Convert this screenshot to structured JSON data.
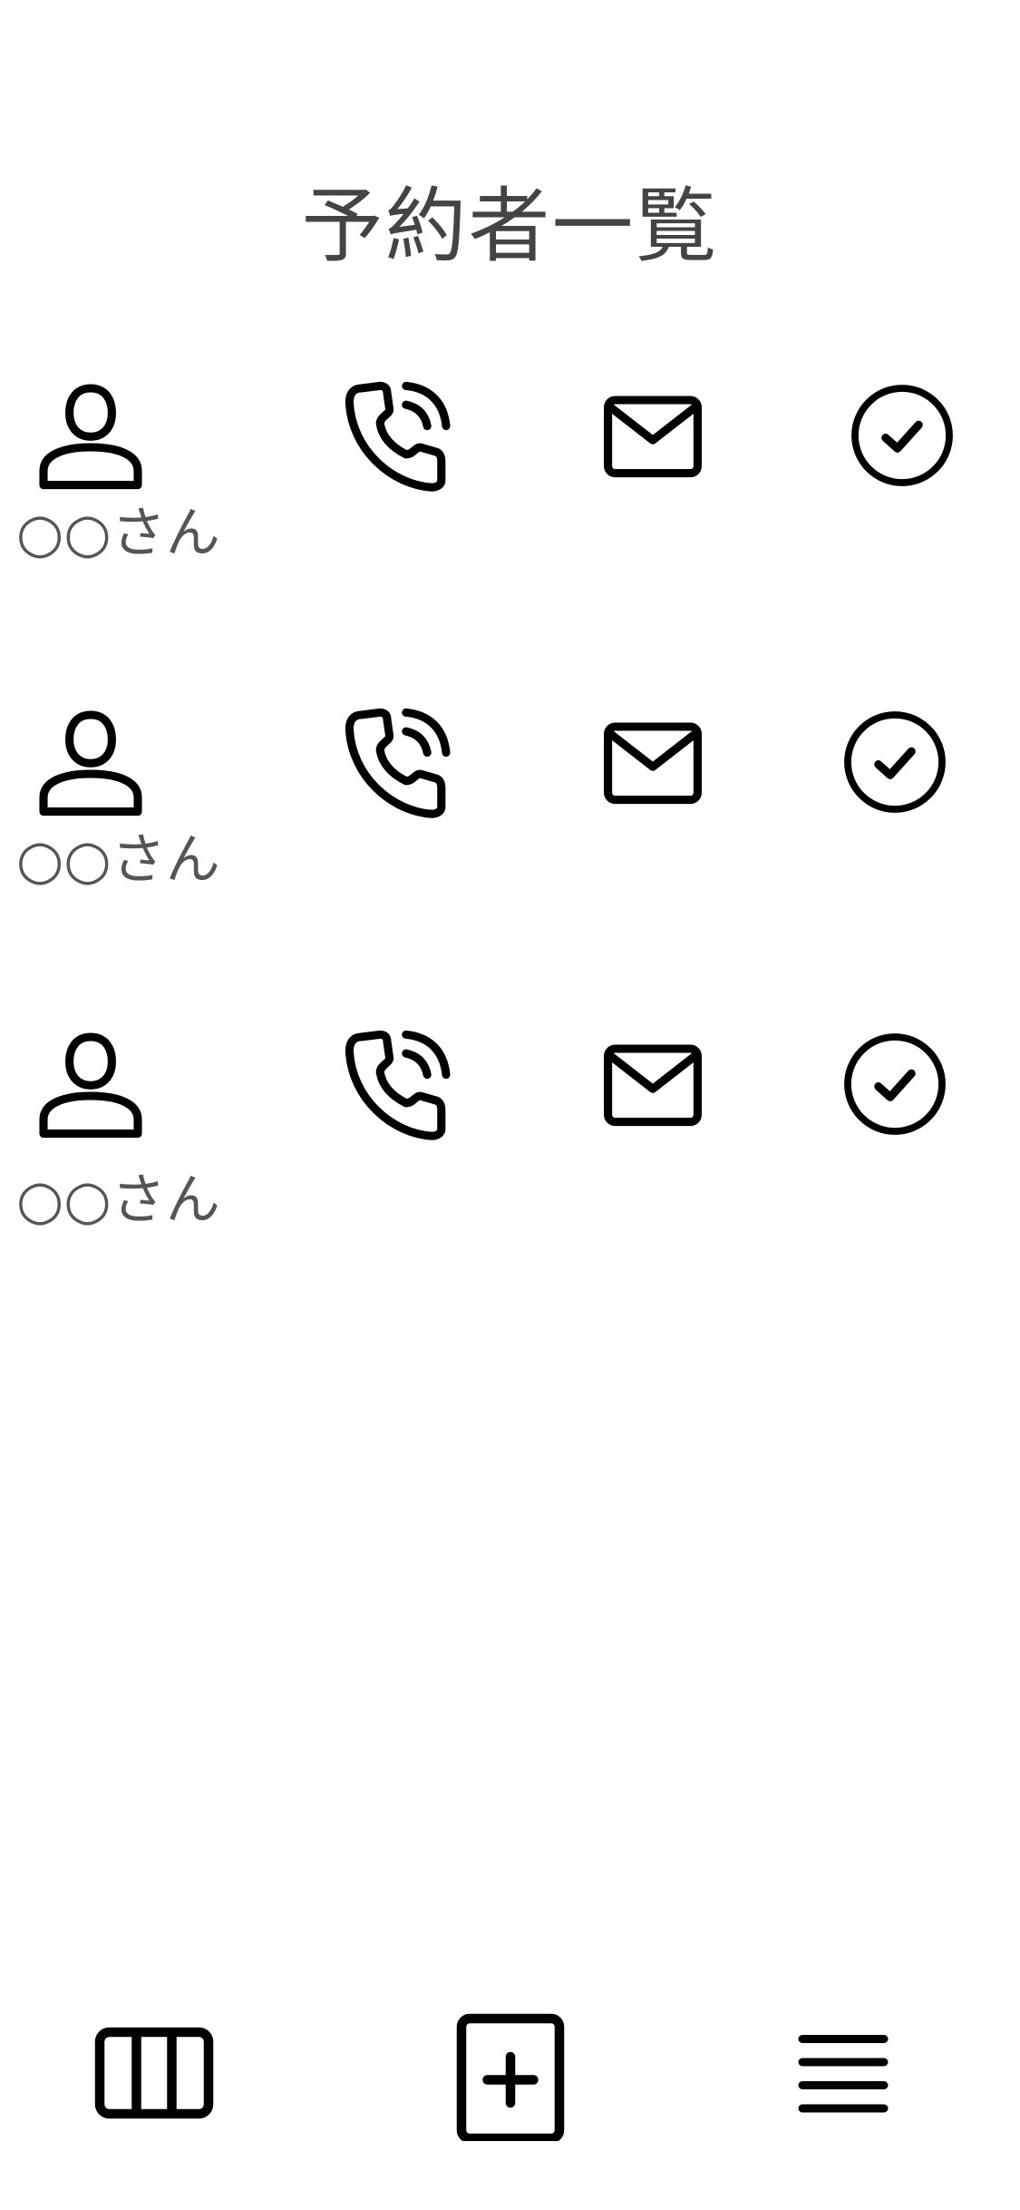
{
  "header": {
    "title": "予約者一覧"
  },
  "reservations": [
    {
      "name": "○○さん"
    },
    {
      "name": "○○さん"
    },
    {
      "name": "○○さん"
    }
  ],
  "row_icons": [
    "person-icon",
    "phone-icon",
    "mail-icon",
    "check-circle-icon"
  ],
  "bottom_nav": {
    "icons": [
      "columns-icon",
      "add-square-icon",
      "menu-icon"
    ]
  },
  "colors": {
    "icon": "#000000",
    "text": "#444444",
    "background": "#ffffff"
  }
}
